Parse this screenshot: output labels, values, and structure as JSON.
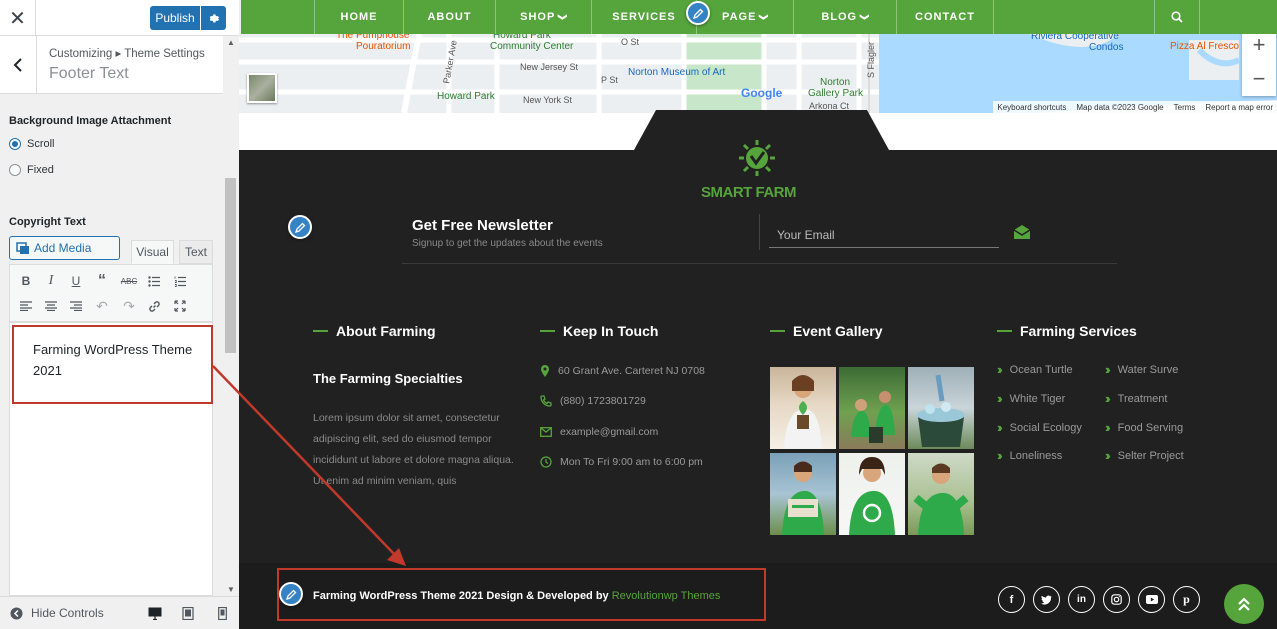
{
  "panel": {
    "publish_label": "Publish",
    "breadcrumb": "Customizing ▸ Theme Settings",
    "section_title": "Footer Text",
    "bg_attachment_label": "Background Image Attachment",
    "radio_scroll": "Scroll",
    "radio_fixed": "Fixed",
    "copyright_label": "Copyright Text",
    "add_media_label": "Add Media",
    "tab_visual": "Visual",
    "tab_text": "Text",
    "editor_content": "Farming WordPress Theme 2021",
    "hide_controls_label": "Hide Controls"
  },
  "nav": {
    "items": [
      "HOME",
      "ABOUT",
      "SHOP",
      "SERVICES",
      "PAGE",
      "BLOG",
      "CONTACT"
    ]
  },
  "map": {
    "labels": [
      "The Pumphouse",
      "Pouratorium",
      "Howard Park",
      "Community Center",
      "O St",
      "New Jersey St",
      "P St",
      "New York St",
      "Howard Park",
      "Norton Museum of Art",
      "Norton",
      "Gallery Park",
      "Arkona Ct",
      "S Flagler",
      "Riviera Cooperative",
      "Condos",
      "Pizza Al Fresco",
      "Parker Ave",
      "Google"
    ],
    "footer_shortcuts": "Keyboard shortcuts",
    "footer_data": "Map data ©2023 Google",
    "footer_terms": "Terms",
    "footer_report": "Report a map error"
  },
  "logo": {
    "text": "SMART FARM"
  },
  "newsletter": {
    "title": "Get Free Newsletter",
    "subtitle": "Signup to get the updates about the events",
    "email_placeholder": "Your Email"
  },
  "columns": {
    "about_title": "About Farming",
    "about_subtitle": "The Farming Specialties",
    "about_body": "Lorem ipsum dolor sit amet, consectetur adipiscing elit, sed do eiusmod tempor incididunt ut labore et dolore magna aliqua. Ut enim ad minim veniam, quis",
    "touch_title": "Keep In Touch",
    "touch_address": "60 Grant Ave. Carteret NJ 0708",
    "touch_phone": "(880) 1723801729",
    "touch_email": "example@gmail.com",
    "touch_hours": "Mon To Fri 9:00 am to 6:00 pm",
    "gallery_title": "Event Gallery",
    "services_title": "Farming Services",
    "services": [
      "Ocean Turtle",
      "Water Surve",
      "White Tiger",
      "Treatment",
      "Social Ecology",
      "Food Serving",
      "Loneliness",
      "Selter Project"
    ]
  },
  "copyright": {
    "text": "Farming WordPress Theme 2021 Design & Developed by ",
    "link": "Revolutionwp Themes"
  },
  "colors": {
    "accent_green": "#56a43c",
    "wp_blue": "#2271b1",
    "footer_bg": "#212121",
    "annotation_red": "#c0392b"
  }
}
